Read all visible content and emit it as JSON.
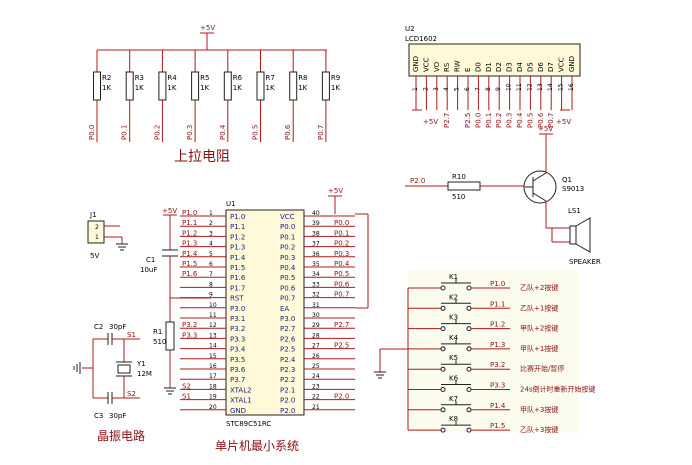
{
  "colors": {
    "wire": "#b01818",
    "part": "#202020",
    "netlabel": "#8b1010",
    "pinlabel": "#1a237e",
    "chip_fill": "#fff9d9",
    "keys_fill": "#fbfbee"
  },
  "vcc_label": "+5V",
  "pullup": {
    "caption": "上拉电阻",
    "resistors": [
      {
        "ref": "R2",
        "val": "1K",
        "net": "P0.0"
      },
      {
        "ref": "R3",
        "val": "1K",
        "net": "P0.1"
      },
      {
        "ref": "R4",
        "val": "1K",
        "net": "P0.2"
      },
      {
        "ref": "R5",
        "val": "1K",
        "net": "P0.3"
      },
      {
        "ref": "R6",
        "val": "1K",
        "net": "P0.4"
      },
      {
        "ref": "R7",
        "val": "1K",
        "net": "P0.5"
      },
      {
        "ref": "R8",
        "val": "1K",
        "net": "P0.6"
      },
      {
        "ref": "R9",
        "val": "1K",
        "net": "P0.7"
      }
    ]
  },
  "lcd": {
    "ref": "U2",
    "part": "LCD1602",
    "pins": [
      {
        "name": "GND",
        "num": "1",
        "net": ""
      },
      {
        "name": "VCC",
        "num": "2",
        "net": "+5V"
      },
      {
        "name": "VO",
        "num": "3",
        "net": ""
      },
      {
        "name": "RS",
        "num": "4",
        "net": "P2.7"
      },
      {
        "name": "RW",
        "num": "5",
        "net": ""
      },
      {
        "name": "E",
        "num": "6",
        "net": "P2.5"
      },
      {
        "name": "D0",
        "num": "7",
        "net": "P0.0"
      },
      {
        "name": "D1",
        "num": "8",
        "net": "P0.1"
      },
      {
        "name": "D2",
        "num": "9",
        "net": "P0.2"
      },
      {
        "name": "D3",
        "num": "10",
        "net": "P0.3"
      },
      {
        "name": "D4",
        "num": "11",
        "net": "P0.4"
      },
      {
        "name": "D5",
        "num": "12",
        "net": "P0.5"
      },
      {
        "name": "D6",
        "num": "13",
        "net": "P0.6"
      },
      {
        "name": "D7",
        "num": "14",
        "net": "P0.7"
      },
      {
        "name": "VCC",
        "num": "15",
        "net": "+5V"
      },
      {
        "name": "GND",
        "num": "16",
        "net": ""
      }
    ]
  },
  "transistor": {
    "ref": "Q1",
    "part": "S9013",
    "r_ref": "R10",
    "r_val": "510",
    "in_net": "P2.0",
    "spk_ref": "LS1",
    "spk_label": "SPEAKER"
  },
  "mcu": {
    "ref": "U1",
    "part": "STC89C51RC",
    "caption": "单片机最小系统",
    "left_pins": [
      {
        "num": "1",
        "name": "P1.0",
        "net": "P1.0"
      },
      {
        "num": "2",
        "name": "P1.1",
        "net": "P1.1"
      },
      {
        "num": "3",
        "name": "P1.2",
        "net": "P1.2"
      },
      {
        "num": "4",
        "name": "P1.3",
        "net": "P1.3"
      },
      {
        "num": "5",
        "name": "P1.4",
        "net": "P1.4"
      },
      {
        "num": "6",
        "name": "P1.5",
        "net": "P1.5"
      },
      {
        "num": "7",
        "name": "P1.6",
        "net": "P1.6"
      },
      {
        "num": "8",
        "name": "P1.7",
        "net": ""
      },
      {
        "num": "9",
        "name": "RST",
        "net": ""
      },
      {
        "num": "10",
        "name": "P3.0",
        "net": ""
      },
      {
        "num": "11",
        "name": "P3.1",
        "net": ""
      },
      {
        "num": "12",
        "name": "P3.2",
        "net": "P3.2"
      },
      {
        "num": "13",
        "name": "P3.3",
        "net": "P3.3"
      },
      {
        "num": "14",
        "name": "P3.4",
        "net": ""
      },
      {
        "num": "15",
        "name": "P3.5",
        "net": ""
      },
      {
        "num": "16",
        "name": "P3.6",
        "net": ""
      },
      {
        "num": "17",
        "name": "P3.7",
        "net": ""
      },
      {
        "num": "18",
        "name": "XTAL2",
        "net": "S2"
      },
      {
        "num": "19",
        "name": "XTAL1",
        "net": "S1"
      },
      {
        "num": "20",
        "name": "GND",
        "net": ""
      }
    ],
    "right_pins": [
      {
        "num": "40",
        "name": "VCC",
        "net": ""
      },
      {
        "num": "39",
        "name": "P0.0",
        "net": "P0.0"
      },
      {
        "num": "38",
        "name": "P0.1",
        "net": "P0.1"
      },
      {
        "num": "37",
        "name": "P0.2",
        "net": "P0.2"
      },
      {
        "num": "36",
        "name": "P0.3",
        "net": "P0.3"
      },
      {
        "num": "35",
        "name": "P0.4",
        "net": "P0.4"
      },
      {
        "num": "34",
        "name": "P0.5",
        "net": "P0.5"
      },
      {
        "num": "33",
        "name": "P0.6",
        "net": "P0.6"
      },
      {
        "num": "32",
        "name": "P0.7",
        "net": "P0.7"
      },
      {
        "num": "31",
        "name": "EA",
        "net": ""
      },
      {
        "num": "30",
        "name": "P3.0",
        "net": ""
      },
      {
        "num": "29",
        "name": "P2.7",
        "net": "P2.7"
      },
      {
        "num": "28",
        "name": "P2.6",
        "net": ""
      },
      {
        "num": "27",
        "name": "P2.5",
        "net": "P2.5"
      },
      {
        "num": "26",
        "name": "P2.4",
        "net": ""
      },
      {
        "num": "25",
        "name": "P2.3",
        "net": ""
      },
      {
        "num": "24",
        "name": "P2.2",
        "net": ""
      },
      {
        "num": "23",
        "name": "P2.1",
        "net": ""
      },
      {
        "num": "22",
        "name": "P2.0",
        "net": "P2.0"
      },
      {
        "num": "21",
        "name": "P2.0",
        "net": ""
      }
    ]
  },
  "power": {
    "ref": "J1",
    "label": "5V",
    "pin1": "1",
    "pin2": "2"
  },
  "reset": {
    "c_ref": "C1",
    "c_val": "10uF",
    "r_ref": "R1",
    "r_val": "510"
  },
  "crystal": {
    "caption": "晶振电路",
    "c2": "C2",
    "c2_val": "30pF",
    "c3": "C3",
    "c3_val": "30pF",
    "y_ref": "Y1",
    "y_val": "12M",
    "s1": "S1",
    "s2": "S2"
  },
  "keys": [
    {
      "ref": "K1",
      "net": "P1.0",
      "desc": "乙队+2按键"
    },
    {
      "ref": "K2",
      "net": "P1.1",
      "desc": "乙队+1按键"
    },
    {
      "ref": "K3",
      "net": "P1.2",
      "desc": "甲队+2按键"
    },
    {
      "ref": "K4",
      "net": "P1.3",
      "desc": "甲队+1按键"
    },
    {
      "ref": "K5",
      "net": "P3.2",
      "desc": "比赛开始/暂停"
    },
    {
      "ref": "K6",
      "net": "P3.3",
      "desc": "24s倒计时重新开始按键"
    },
    {
      "ref": "K7",
      "net": "P1.4",
      "desc": "甲队+3按键"
    },
    {
      "ref": "K8",
      "net": "P1.5",
      "desc": "乙队+3按键"
    }
  ]
}
